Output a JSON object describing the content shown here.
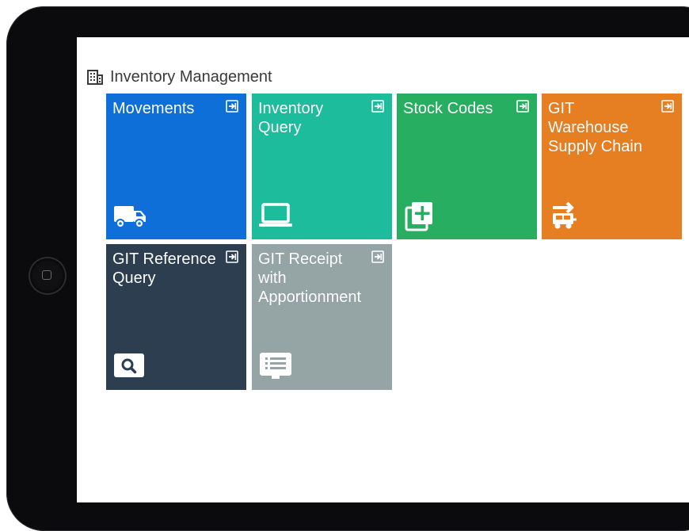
{
  "section": {
    "title": "Inventory Management",
    "icon": "building-icon"
  },
  "tiles": [
    {
      "label": "Movements",
      "icon": "truck-icon",
      "color": "#0f6fd8"
    },
    {
      "label": "Inventory Query",
      "icon": "laptop-icon",
      "color": "#1dbc9c"
    },
    {
      "label": "Stock Codes",
      "icon": "add-copy-icon",
      "color": "#27ae60"
    },
    {
      "label": "GIT Warehouse Supply Chain",
      "icon": "transfer-icon",
      "color": "#e67e22"
    },
    {
      "label": "GIT Reference Query",
      "icon": "search-icon",
      "color": "#2c3e50"
    },
    {
      "label": "GIT Receipt with Apportionment",
      "icon": "list-monitor-icon",
      "color": "#95a5a6"
    }
  ],
  "colors": {
    "device_bezel": "#0b0b0d",
    "screen": "#ffffff",
    "text": "#3a3a3a"
  }
}
